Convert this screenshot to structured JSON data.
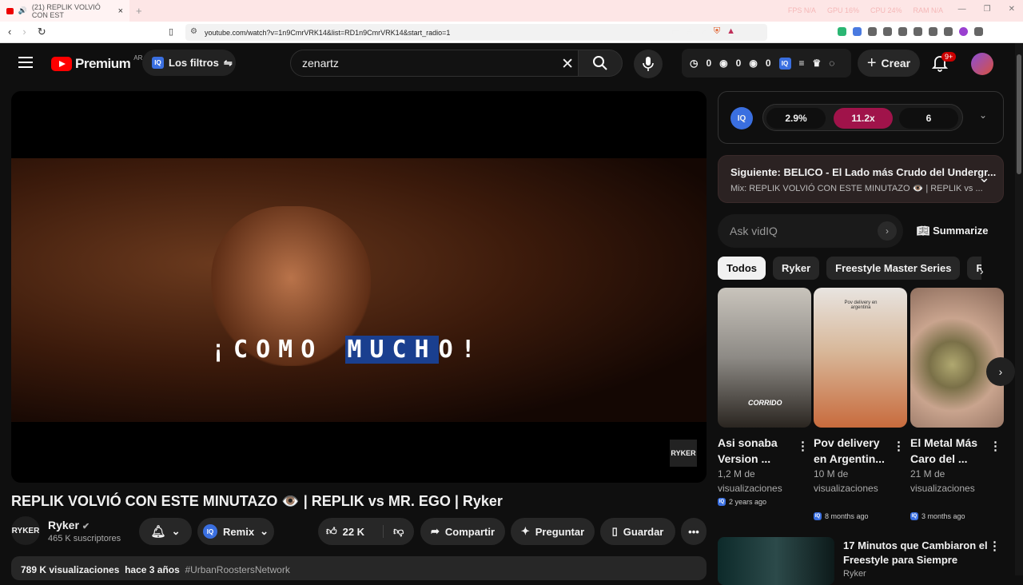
{
  "browser": {
    "tab_title": "(21) REPLIK VOLVIÓ CON EST",
    "url": "youtube.com/watch?v=1n9CmrVRK14&list=RD1n9CmrVRK14&start_radio=1",
    "sys_stats": [
      "FPS N/A",
      "GPU 16%",
      "CPU 24%",
      "RAM N/A"
    ]
  },
  "header": {
    "brand": "Premium",
    "country": "AR",
    "filters_label": "Los filtros",
    "search_value": "zenartz",
    "counters": [
      "0",
      "0",
      "0"
    ],
    "create_label": "Crear",
    "notif_count": "9+"
  },
  "video": {
    "lyric_plain": "¡COMO ",
    "lyric_highlight": "MUCH",
    "lyric_rest": "O!",
    "watermark": "RYKER",
    "title": "REPLIK VOLVIÓ CON ESTE MINUTAZO 👁️ | REPLIK vs MR. EGO | Ryker",
    "channel": "Ryker",
    "subscribers": "465 K suscriptores",
    "remix_label": "Remix",
    "likes": "22 K",
    "share_label": "Compartir",
    "ask_label": "Preguntar",
    "save_label": "Guardar",
    "views": "789 K visualizaciones",
    "date": "hace 3 años",
    "hashtag": "#UrbanRoostersNetwork"
  },
  "vidiq": {
    "stat1": "2.9%",
    "stat2": "11.2x",
    "stat3": "6",
    "accent": "#a0134a"
  },
  "next_up": {
    "line1": "Siguiente: BELICO - El Lado más Crudo del Undergr...",
    "line2": "Mix: REPLIK VOLVIÓ CON ESTE MINUTAZO 👁️ | REPLIK vs ..."
  },
  "ask": {
    "placeholder": "Ask vidIQ",
    "summarize": "Summarize"
  },
  "chips": [
    "Todos",
    "Ryker",
    "Freestyle Master Series",
    "Rel"
  ],
  "shorts": [
    {
      "title1": "Asi sonaba",
      "title2": "Version ...",
      "views1": "1,2 M de",
      "views2": "visualizaciones",
      "date": "2 years ago",
      "caption": "CORRIDO"
    },
    {
      "title1": "Pov delivery",
      "title2": "en Argentin...",
      "views1": "10 M de",
      "views2": "visualizaciones",
      "date": "8 months ago",
      "caption": "Pov delivery en argentina"
    },
    {
      "title1": "El Metal Más",
      "title2": "Caro del ...",
      "views1": "21 M de",
      "views2": "visualizaciones",
      "date": "3 months ago",
      "caption": ""
    }
  ],
  "recommended": {
    "title": "17 Minutos que Cambiaron el Freestyle para Siempre",
    "channel": "Ryker"
  }
}
